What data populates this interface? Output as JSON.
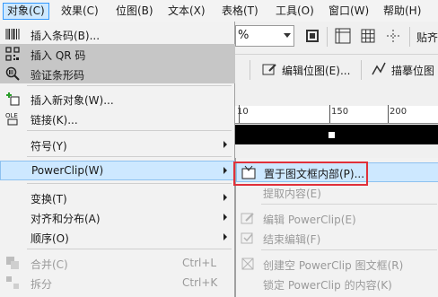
{
  "menubar": {
    "items": [
      {
        "label": "对象(C)"
      },
      {
        "label": "效果(C)"
      },
      {
        "label": "位图(B)"
      },
      {
        "label": "文本(X)"
      },
      {
        "label": "表格(T)"
      },
      {
        "label": "工具(O)"
      },
      {
        "label": "窗口(W)"
      },
      {
        "label": "帮助(H)"
      }
    ]
  },
  "toolbar": {
    "percent_text": "%",
    "edit_bitmap_label": "编辑位图(E)...",
    "trace_bitmap_label": "描摹位图",
    "paste_label": "贴齐"
  },
  "ruler": {
    "labels": [
      "10",
      "150",
      "200"
    ]
  },
  "menu": {
    "items": [
      {
        "label": "插入条码(B)...",
        "icon": "barcode-icon"
      },
      {
        "label": "插入 QR 码",
        "icon": "qr-code-icon"
      },
      {
        "label": "验证条形码",
        "icon": "verify-barcode-icon"
      },
      {
        "label": "插入新对象(W)...",
        "icon": "insert-object-icon"
      },
      {
        "label": "链接(K)...",
        "icon": "ole-link-icon"
      },
      {
        "label": "符号(Y)"
      },
      {
        "label": "PowerClip(W)"
      },
      {
        "label": "变换(T)"
      },
      {
        "label": "对齐和分布(A)"
      },
      {
        "label": "顺序(O)"
      },
      {
        "label": "合并(C)",
        "shortcut": "Ctrl+L"
      },
      {
        "label": "拆分",
        "shortcut": "Ctrl+K"
      }
    ]
  },
  "submenu": {
    "items": [
      {
        "label": "置于图文框内部(P)..."
      },
      {
        "label": "提取内容(E)"
      },
      {
        "label": "编辑 PowerClip(E)"
      },
      {
        "label": "结束编辑(F)"
      },
      {
        "label": "创建空 PowerClip 图文框(R)"
      },
      {
        "label": "锁定 PowerClip 的内容(K)"
      }
    ]
  }
}
